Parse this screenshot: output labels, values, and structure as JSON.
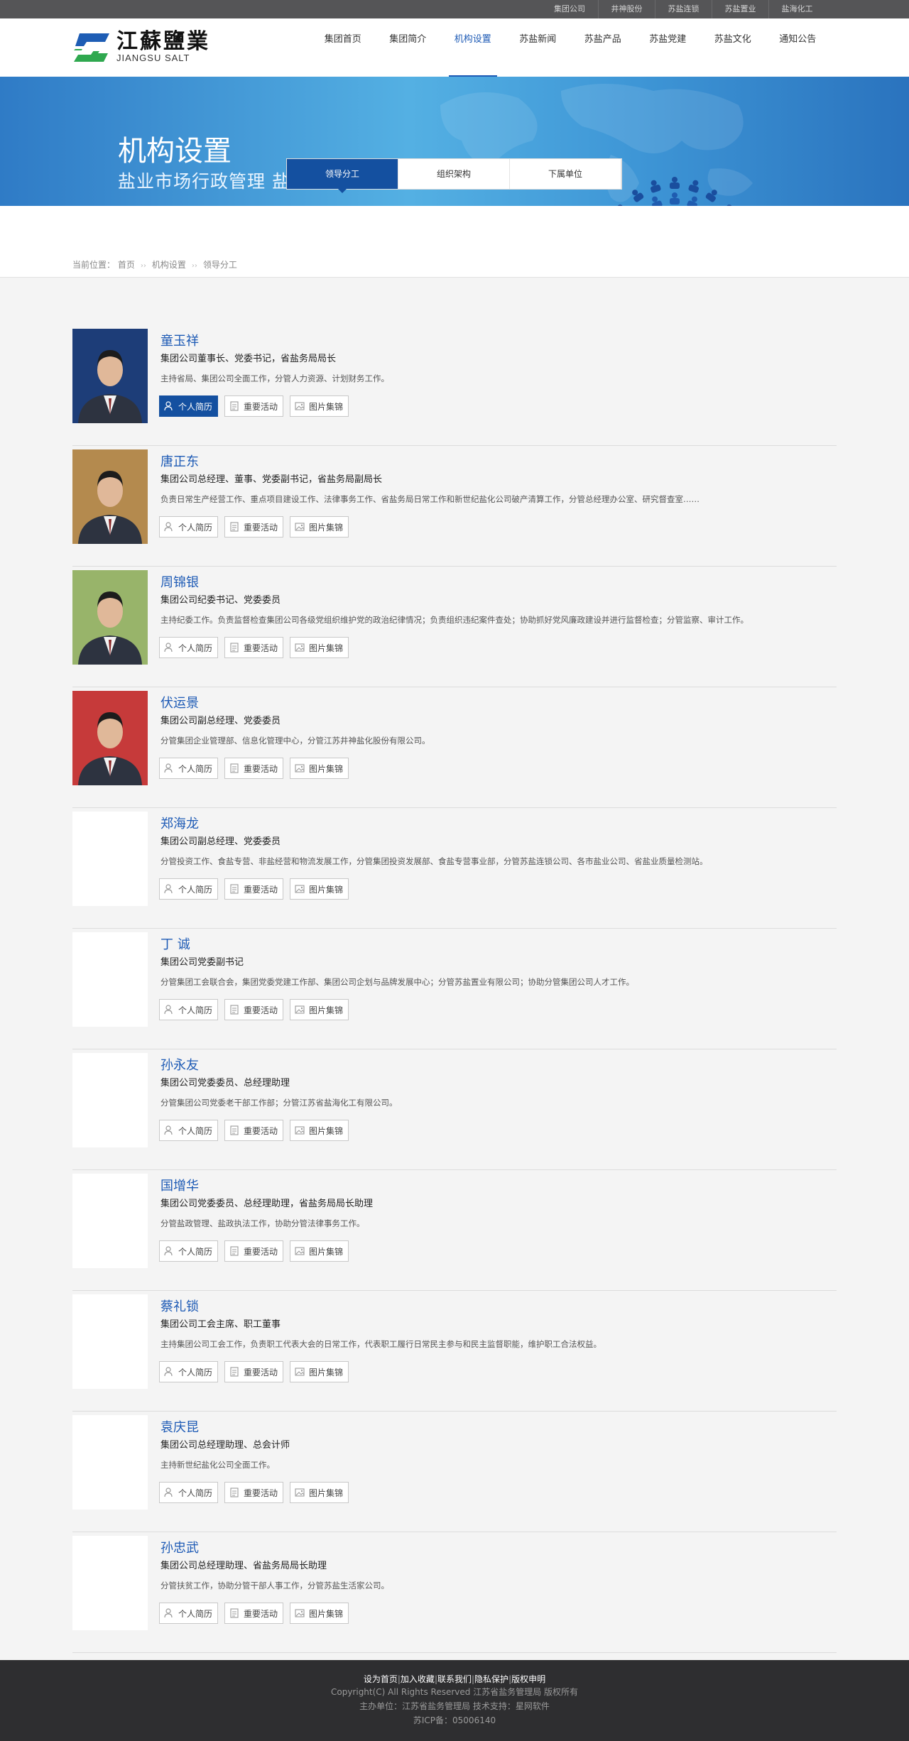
{
  "topbar": {
    "links": [
      "集团公司",
      "井神股份",
      "苏盐连锁",
      "苏盐置业",
      "盐海化工"
    ]
  },
  "logo": {
    "cn": "江蘇鹽業",
    "en": "JIANGSU SALT"
  },
  "nav": {
    "items": [
      "集团首页",
      "集团简介",
      "机构设置",
      "苏盐新闻",
      "苏盐产品",
      "苏盐党建",
      "苏盐文化",
      "通知公告"
    ],
    "active_index": 2
  },
  "banner": {
    "title": "机构设置",
    "subtitle": "盐业市场行政管理   盐政执法"
  },
  "tabs": {
    "items": [
      "领导分工",
      "组织架构",
      "下属单位"
    ],
    "active_index": 0
  },
  "breadcrumb": {
    "label": "当前位置：",
    "items": [
      "首页",
      "机构设置",
      "领导分工"
    ],
    "separator": "››"
  },
  "buttons": {
    "resume": "个人简历",
    "activities": "重要活动",
    "gallery": "图片集锦"
  },
  "people": [
    {
      "name": "童玉祥",
      "title": "集团公司董事长、党委书记，省盐务局局长",
      "desc": "主持省局、集团公司全面工作，分管人力资源、计划财务工作。",
      "photo": "photo-blue"
    },
    {
      "name": "唐正东",
      "title": "集团公司总经理、董事、党委副书记，省盐务局副局长",
      "desc": "负责日常生产经营工作、重点项目建设工作、法律事务工作、省盐务局日常工作和新世纪盐化公司破产清算工作，分管总经理办公室、研究督查室……",
      "photo": "photo-wood"
    },
    {
      "name": "周锦银",
      "title": "集团公司纪委书记、党委委员",
      "desc": "主持纪委工作。负责监督检查集团公司各级党组织维护党的政治纪律情况；负责组织违纪案件查处；协助抓好党风廉政建设并进行监督检查；分管监察、审计工作。",
      "photo": "photo-green"
    },
    {
      "name": "伏运景",
      "title": "集团公司副总经理、党委委员",
      "desc": "分管集团企业管理部、信息化管理中心，分管江苏井神盐化股份有限公司。",
      "photo": "photo-red"
    },
    {
      "name": "郑海龙",
      "title": "集团公司副总经理、党委委员",
      "desc": "分管投资工作、食盐专营、非盐经营和物流发展工作，分管集团投资发展部、食盐专营事业部，分管苏盐连锁公司、各市盐业公司、省盐业质量检测站。",
      "photo": ""
    },
    {
      "name": "丁  诚",
      "title": "集团公司党委副书记",
      "desc": "分管集团工会联合会，集团党委党建工作部、集团公司企划与品牌发展中心；分管苏盐置业有限公司；协助分管集团公司人才工作。",
      "photo": ""
    },
    {
      "name": "孙永友",
      "title": "集团公司党委委员、总经理助理",
      "desc": "分管集团公司党委老干部工作部；分管江苏省盐海化工有限公司。",
      "photo": ""
    },
    {
      "name": "国增华",
      "title": "集团公司党委委员、总经理助理，省盐务局局长助理",
      "desc": "分管盐政管理、盐政执法工作，协助分管法律事务工作。",
      "photo": ""
    },
    {
      "name": "蔡礼锁",
      "title": "集团公司工会主席、职工董事",
      "desc": "主持集团公司工会工作，负责职工代表大会的日常工作，代表职工履行日常民主参与和民主监督职能，维护职工合法权益。",
      "photo": ""
    },
    {
      "name": "袁庆昆",
      "title": "集团公司总经理助理、总会计师",
      "desc": "主持新世纪盐化公司全面工作。",
      "photo": ""
    },
    {
      "name": "孙忠武",
      "title": "集团公司总经理助理、省盐务局局长助理",
      "desc": "分管扶贫工作，协助分管干部人事工作，分管苏盐生活家公司。",
      "photo": ""
    }
  ],
  "footer": {
    "links": [
      "设为首页",
      "加入收藏",
      "联系我们",
      "隐私保护",
      "版权申明"
    ],
    "copyright": "Copyright(C) All Rights Reserved 江苏省盐务管理局 版权所有",
    "host": "主办单位：江苏省盐务管理局   技术支持：星网软件",
    "icp": "苏ICP备：05006140"
  },
  "colors": {
    "primary": "#1450a0",
    "link": "#1d5ab5",
    "topbar": "#555557",
    "footer": "#2e2e30",
    "logo_blue": "#1e5db5",
    "logo_green": "#2fa84f"
  }
}
